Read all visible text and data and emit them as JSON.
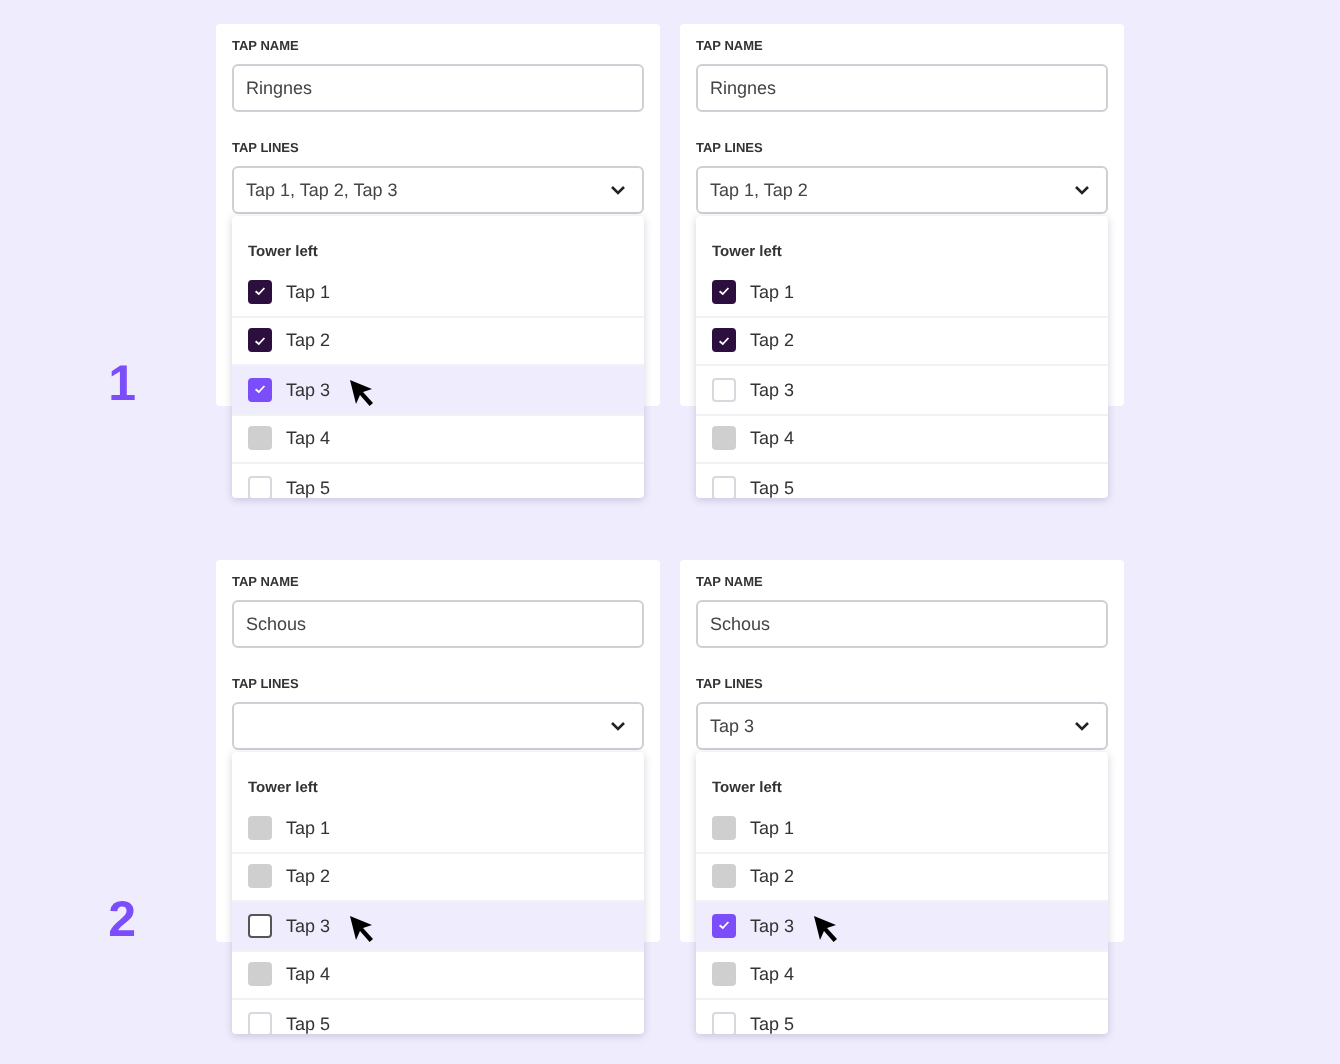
{
  "scenarios": [
    {
      "number": "1",
      "panels": [
        {
          "name_label": "TAP NAME",
          "name_value": "Ringnes",
          "lines_label": "TAP LINES",
          "lines_value": "Tap 1, Tap 2, Tap 3",
          "group": "Tower left",
          "options": [
            {
              "label": "Tap 1",
              "checked": true,
              "disabled": false,
              "highlighted": false
            },
            {
              "label": "Tap 2",
              "checked": true,
              "disabled": false,
              "highlighted": false
            },
            {
              "label": "Tap 3",
              "checked": true,
              "disabled": false,
              "highlighted": true
            },
            {
              "label": "Tap 4",
              "checked": false,
              "disabled": true,
              "highlighted": false
            },
            {
              "label": "Tap 5",
              "checked": false,
              "disabled": false,
              "highlighted": false
            }
          ]
        },
        {
          "name_label": "TAP NAME",
          "name_value": "Ringnes",
          "lines_label": "TAP LINES",
          "lines_value": "Tap 1, Tap 2",
          "group": "Tower left",
          "options": [
            {
              "label": "Tap 1",
              "checked": true,
              "disabled": false,
              "highlighted": false
            },
            {
              "label": "Tap 2",
              "checked": true,
              "disabled": false,
              "highlighted": false
            },
            {
              "label": "Tap 3",
              "checked": false,
              "disabled": false,
              "highlighted": false
            },
            {
              "label": "Tap 4",
              "checked": false,
              "disabled": true,
              "highlighted": false
            },
            {
              "label": "Tap 5",
              "checked": false,
              "disabled": false,
              "highlighted": false
            }
          ]
        }
      ]
    },
    {
      "number": "2",
      "panels": [
        {
          "name_label": "TAP NAME",
          "name_value": "Schous",
          "lines_label": "TAP LINES",
          "group": "Tower left",
          "options": [
            {
              "label": "Tap 1",
              "checked": false,
              "disabled": true,
              "highlighted": false
            },
            {
              "label": "Tap 2",
              "checked": false,
              "disabled": true,
              "highlighted": false
            },
            {
              "label": "Tap 3",
              "checked": false,
              "disabled": false,
              "highlighted": true
            },
            {
              "label": "Tap 4",
              "checked": false,
              "disabled": true,
              "highlighted": false
            },
            {
              "label": "Tap 5",
              "checked": false,
              "disabled": false,
              "highlighted": false
            }
          ]
        },
        {
          "name_label": "TAP NAME",
          "name_value": "Schous",
          "lines_label": "TAP LINES",
          "lines_value": "Tap 3",
          "group": "Tower left",
          "options": [
            {
              "label": "Tap 1",
              "checked": false,
              "disabled": true,
              "highlighted": false
            },
            {
              "label": "Tap 2",
              "checked": false,
              "disabled": true,
              "highlighted": false
            },
            {
              "label": "Tap 3",
              "checked": true,
              "disabled": false,
              "highlighted": true
            },
            {
              "label": "Tap 4",
              "checked": false,
              "disabled": true,
              "highlighted": false
            },
            {
              "label": "Tap 5",
              "checked": false,
              "disabled": false,
              "highlighted": false
            }
          ]
        }
      ]
    }
  ]
}
